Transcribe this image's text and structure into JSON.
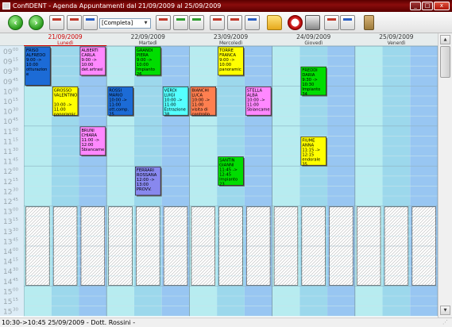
{
  "window": {
    "title": "ConfiDENT - Agenda Appuntamenti dal 21/09/2009 al 25/09/2009",
    "minimize": "_",
    "maximize": "□",
    "close": "x"
  },
  "toolbar": {
    "back_icon": "back-arrow-icon",
    "forward_icon": "forward-arrow-icon",
    "view_select": "[Completa]"
  },
  "days": [
    {
      "date": "21/09/2009",
      "name": "Lunedì"
    },
    {
      "date": "22/09/2009",
      "name": "Martedì"
    },
    {
      "date": "23/09/2009",
      "name": "Mercoledì"
    },
    {
      "date": "24/09/2009",
      "name": "Giovedì"
    },
    {
      "date": "25/09/2009",
      "name": "Venerdì"
    }
  ],
  "times": [
    "0900",
    "0915",
    "0930",
    "0945",
    "1000",
    "1015",
    "1030",
    "1045",
    "1100",
    "1115",
    "1130",
    "1145",
    "1200",
    "1215",
    "1230",
    "1245",
    "1300",
    "1315",
    "1330",
    "1345",
    "1400",
    "1415",
    "1430",
    "1445",
    "1500",
    "1515",
    "1530"
  ],
  "colors": {
    "header_bg": "#e7ecec",
    "time_bg": "#dcecf6",
    "cell_a": "#b7ecf0",
    "cell_b": "#9cd8ec",
    "cell_c": "#98c6f2",
    "today_text": "#cc0000",
    "blocked": "#ffffff"
  },
  "appointments": [
    {
      "day": 0,
      "col": 0,
      "start": 0,
      "end": 4,
      "color": "#1c6bd6",
      "lines": [
        "FRISO",
        "ALFREDO",
        "9:00 ->",
        "10:00",
        "otturazion",
        "e"
      ]
    },
    {
      "day": 0,
      "col": 1,
      "start": 4,
      "end": 7,
      "color": "#ffff00",
      "lines": [
        "GROSSO",
        "VALENTINO",
        "",
        "10:00 ->",
        "11:00",
        "panoramic"
      ]
    },
    {
      "day": 0,
      "col": 2,
      "start": 0,
      "end": 3,
      "color": "#ff88ff",
      "lines": [
        "ALBERTI",
        "CARLA",
        "9:00 ->",
        "10:00",
        "det.artrasi"
      ]
    },
    {
      "day": 0,
      "col": 2,
      "start": 8,
      "end": 11,
      "color": "#ff88ff",
      "lines": [
        "BRUNI",
        "CHIARA",
        "11:00 ->",
        "12:00",
        "Sbiancame"
      ]
    },
    {
      "day": 1,
      "col": 0,
      "start": 4,
      "end": 7,
      "color": "#1c6bd6",
      "lines": [
        "ROSSI",
        "MARIO",
        "10:00 ->",
        "11:00",
        "ott.comp.",
        "25"
      ]
    },
    {
      "day": 1,
      "col": 1,
      "start": 0,
      "end": 3,
      "color": "#00dd00",
      "lines": [
        "GRANDI",
        "PIERA",
        "9:00 ->",
        "10:00",
        "Impianto",
        "26"
      ]
    },
    {
      "day": 1,
      "col": 1,
      "start": 12,
      "end": 15,
      "color": "#8888ee",
      "lines": [
        "FERRARI",
        "ROSSANA",
        "12:00 ->",
        "13:00",
        "PROVV."
      ]
    },
    {
      "day": 1,
      "col": 2,
      "start": 4,
      "end": 7,
      "color": "#55ffff",
      "lines": [
        "VERDI",
        "LUIGI",
        "10:00 ->",
        "11:00",
        "Estrazione",
        "38"
      ]
    },
    {
      "day": 2,
      "col": 0,
      "start": 4,
      "end": 7,
      "color": "#ff7f50",
      "lines": [
        "BIANCHI",
        "LUCA",
        "10:00 ->",
        "11:00",
        "visita di",
        "controllo"
      ]
    },
    {
      "day": 2,
      "col": 1,
      "start": 0,
      "end": 3,
      "color": "#ffff00",
      "lines": [
        "TORRE",
        "FRANCA",
        "9:00 ->",
        "10:00",
        "panoramic"
      ]
    },
    {
      "day": 2,
      "col": 1,
      "start": 11,
      "end": 14,
      "color": "#00dd00",
      "lines": [
        "SANTIN",
        "GIANNI",
        "11:45 ->",
        "12:45",
        "Impianto",
        "23"
      ]
    },
    {
      "day": 2,
      "col": 2,
      "start": 4,
      "end": 7,
      "color": "#ff88ff",
      "lines": [
        "STELLA",
        "ALBA",
        "10:00 ->",
        "11:00",
        "Sbiancame"
      ]
    },
    {
      "day": 3,
      "col": 1,
      "start": 2,
      "end": 5,
      "color": "#00dd00",
      "lines": [
        "FREDDI",
        "DARIA",
        "9:30 ->",
        "10:30",
        "Impianto",
        "34"
      ]
    },
    {
      "day": 3,
      "col": 1,
      "start": 9,
      "end": 12,
      "color": "#ffff00",
      "lines": [
        "FIUME",
        "ANNA",
        "11:15 ->",
        "12:15",
        "endorale",
        "35"
      ]
    }
  ],
  "status": {
    "text": "10:30->10:45 25/09/2009 - Dott. Rossini -"
  }
}
